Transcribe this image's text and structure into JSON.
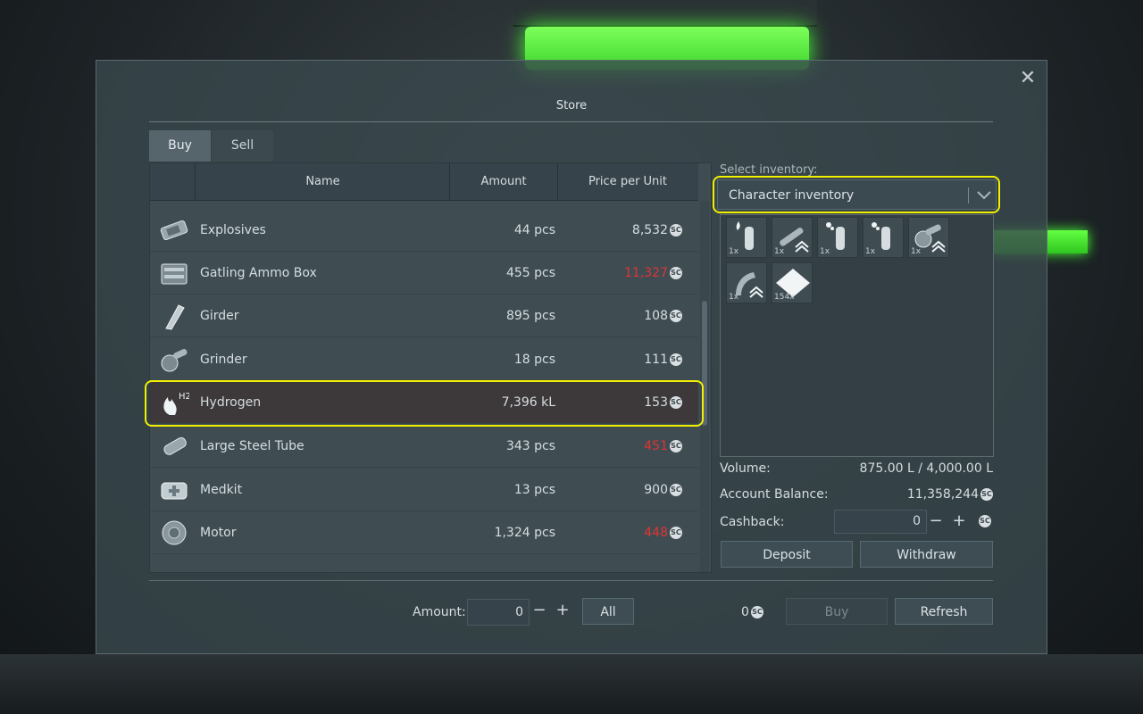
{
  "window": {
    "title": "Store"
  },
  "tabs": [
    {
      "label": "Buy",
      "active": true
    },
    {
      "label": "Sell",
      "active": false
    }
  ],
  "table": {
    "columns": [
      "Name",
      "Amount",
      "Price per Unit"
    ],
    "rows": [
      {
        "icon": "explosives-icon",
        "name": "Explosives",
        "amount": "44 pcs",
        "price": "8,532",
        "price_red": false
      },
      {
        "icon": "ammo-box-icon",
        "name": "Gatling Ammo Box",
        "amount": "455 pcs",
        "price": "11,327",
        "price_red": true
      },
      {
        "icon": "girder-icon",
        "name": "Girder",
        "amount": "895 pcs",
        "price": "108",
        "price_red": false
      },
      {
        "icon": "grinder-icon",
        "name": "Grinder",
        "amount": "18 pcs",
        "price": "111",
        "price_red": false
      },
      {
        "icon": "hydrogen-icon",
        "name": "Hydrogen",
        "amount": "7,396 kL",
        "price": "153",
        "price_red": false,
        "selected": true
      },
      {
        "icon": "steel-tube-icon",
        "name": "Large Steel Tube",
        "amount": "343 pcs",
        "price": "451",
        "price_red": true
      },
      {
        "icon": "medkit-icon",
        "name": "Medkit",
        "amount": "13 pcs",
        "price": "900",
        "price_red": false
      },
      {
        "icon": "motor-icon",
        "name": "Motor",
        "amount": "1,324 pcs",
        "price": "448",
        "price_red": true
      }
    ]
  },
  "currency_symbol": "SC",
  "inventory": {
    "select_label": "Select inventory:",
    "selected": "Character inventory",
    "slots": [
      {
        "icon": "oxygen-bottle-icon",
        "qty": "1x"
      },
      {
        "icon": "welder-icon",
        "qty": "1x"
      },
      {
        "icon": "hydrogen-bottle-icon",
        "qty": "1x"
      },
      {
        "icon": "hydrogen-bottle-icon",
        "qty": "1x"
      },
      {
        "icon": "grinder-icon",
        "qty": "1x"
      },
      {
        "icon": "drill-icon",
        "qty": "1x"
      },
      {
        "icon": "ore-icon",
        "qty": "154x"
      }
    ]
  },
  "info": {
    "volume_label": "Volume:",
    "volume_value": "875.00 L / 4,000.00 L",
    "balance_label": "Account Balance:",
    "balance_value": "11,358,244",
    "cashback_label": "Cashback:",
    "cashback_value": "0"
  },
  "buttons": {
    "deposit": "Deposit",
    "withdraw": "Withdraw",
    "all": "All",
    "buy": "Buy",
    "refresh": "Refresh",
    "minus": "−",
    "plus": "+",
    "close": "✕"
  },
  "footer": {
    "amount_label": "Amount:",
    "amount_value": "0",
    "total": "0"
  },
  "colors": {
    "highlight": "#f2f000",
    "price_red": "#e03434",
    "accent_green": "#4cff3a"
  }
}
